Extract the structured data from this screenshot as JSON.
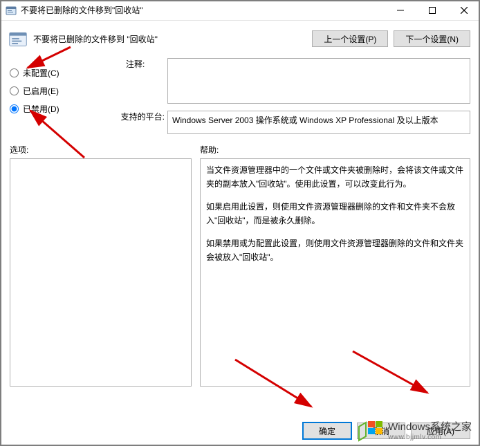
{
  "window": {
    "title": "不要将已删除的文件移到\"回收站\""
  },
  "header": {
    "title": "不要将已删除的文件移到 \"回收站\"",
    "prev_btn": "上一个设置(P)",
    "next_btn": "下一个设置(N)"
  },
  "radios": {
    "not_configured": "未配置(C)",
    "enabled": "已启用(E)",
    "disabled": "已禁用(D)",
    "selected": "disabled"
  },
  "labels": {
    "comment": "注释:",
    "platform": "支持的平台:",
    "options": "选项:",
    "help": "帮助:"
  },
  "fields": {
    "comment_value": "",
    "platform_value": "Windows Server 2003 操作系统或 Windows XP Professional 及以上版本"
  },
  "help": {
    "p1": "当文件资源管理器中的一个文件或文件夹被删除时，会将该文件或文件夹的副本放入\"回收站\"。使用此设置，可以改变此行为。",
    "p2": "如果启用此设置，则使用文件资源管理器删除的文件和文件夹不会放入\"回收站\"，而是被永久删除。",
    "p3": "如果禁用或为配置此设置，则使用文件资源管理器删除的文件和文件夹会被放入\"回收站\"。"
  },
  "footer": {
    "ok": "确定",
    "cancel": "取消",
    "apply": "应用(A)"
  },
  "watermark": {
    "line1": "Windows系统之家",
    "line2": "www.bjjmlv.com"
  },
  "colors": {
    "arrow": "#d40000",
    "accent": "#0078d7"
  }
}
